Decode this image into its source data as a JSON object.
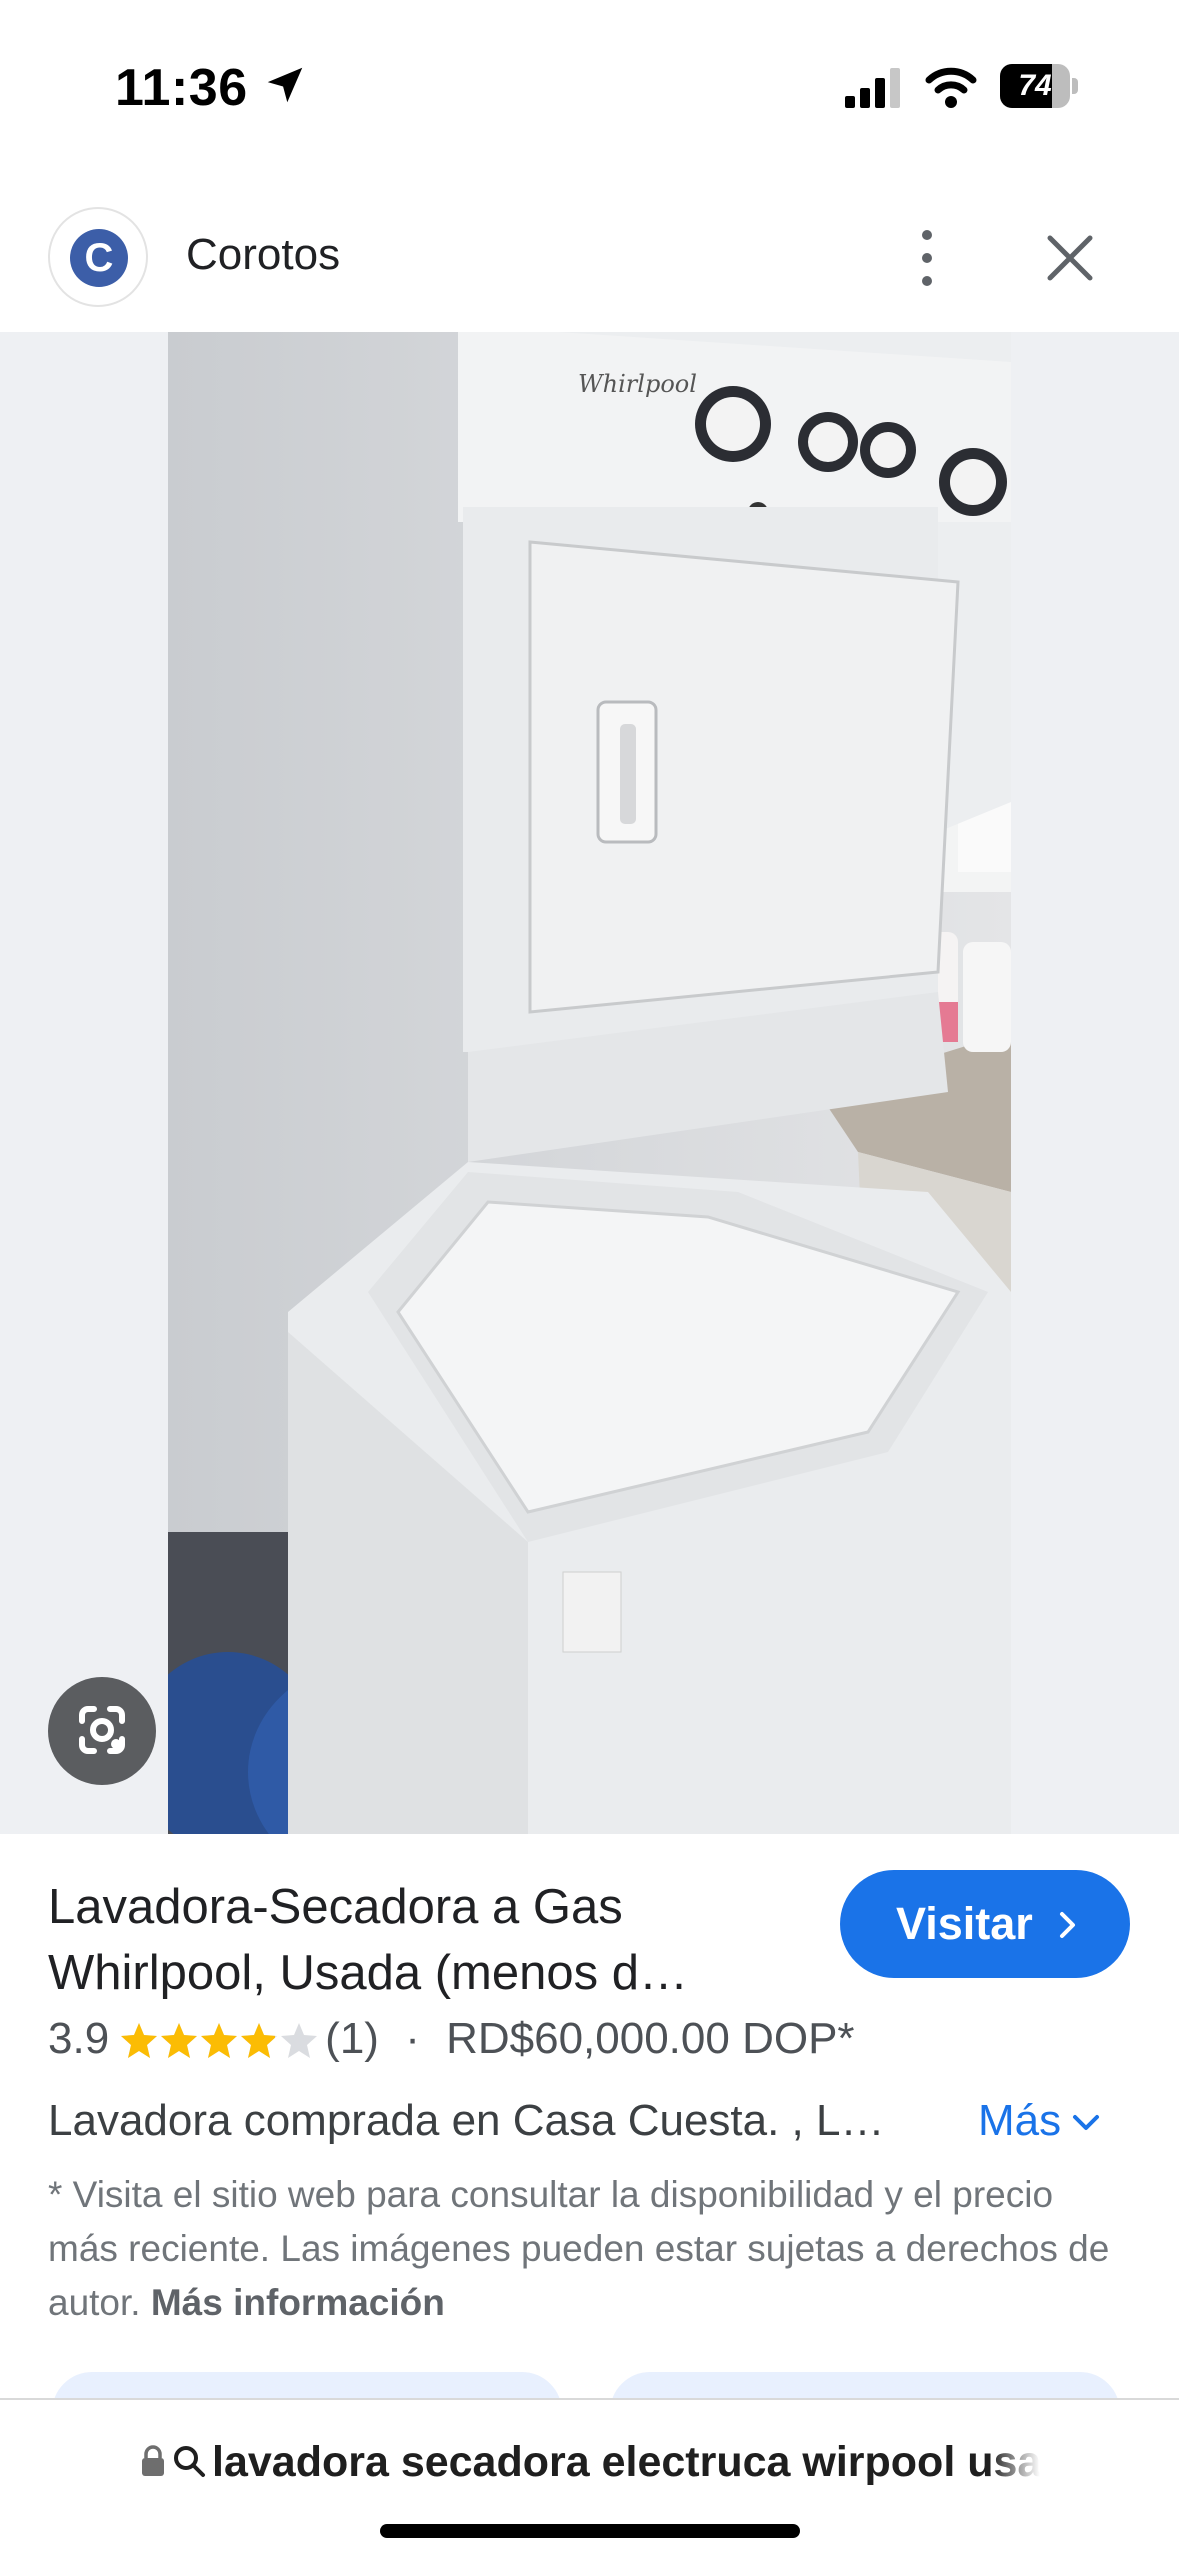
{
  "status_bar": {
    "time": "11:36",
    "battery": "74",
    "battery_level": 0.74
  },
  "header": {
    "site_initial": "C",
    "site_name": "Corotos"
  },
  "product": {
    "title_line1": "Lavadora-Secadora a Gas",
    "title_line2": "Whirlpool, Usada (menos d…",
    "visit_label": "Visitar",
    "rating": "3.9",
    "stars": 3.9,
    "review_count": "(1)",
    "separator": "·",
    "price": "RD$60,000.00 DOP*",
    "description": "Lavadora comprada en Casa Cuesta. , L…",
    "more_label": "Más",
    "disclaimer": "* Visita el sitio web para consultar la disponibilidad y el precio más reciente. Las imágenes pueden estar sujetas a derechos de autor.",
    "more_info_label": "Más información"
  },
  "image_brand": "Whirlpool",
  "address_bar": {
    "query": "lavadora secadora electruca wirpool usada"
  },
  "colors": {
    "accent": "#1a73e8",
    "star": "#fbbc04",
    "site_logo": "#3c5ea8"
  }
}
